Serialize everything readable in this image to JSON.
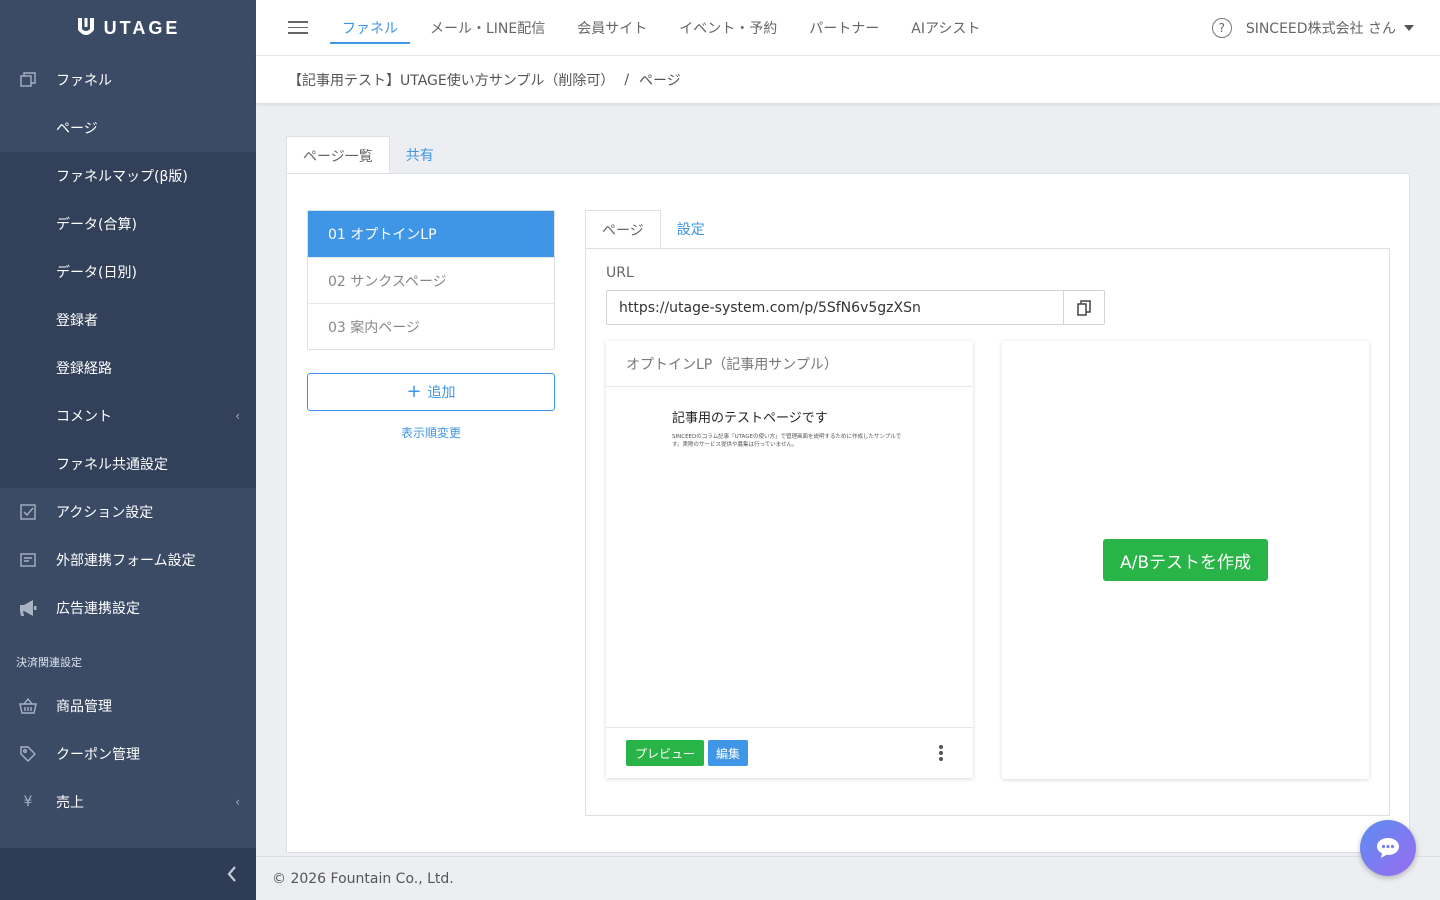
{
  "brand": {
    "name": "UTAGE"
  },
  "sidebar": {
    "items": [
      {
        "label": "ファネル",
        "icon": "copy-icon"
      },
      {
        "label": "ページ"
      },
      {
        "label": "ファネルマップ(β版)"
      },
      {
        "label": "データ(合算)"
      },
      {
        "label": "データ(日別)"
      },
      {
        "label": "登録者"
      },
      {
        "label": "登録経路"
      },
      {
        "label": "コメント"
      },
      {
        "label": "ファネル共通設定"
      },
      {
        "label": "アクション設定",
        "icon": "checkbox-icon"
      },
      {
        "label": "外部連携フォーム設定",
        "icon": "form-icon"
      },
      {
        "label": "広告連携設定",
        "icon": "megaphone-icon"
      }
    ],
    "section_payment": "決済関連設定",
    "payment_items": [
      {
        "label": "商品管理",
        "icon": "basket-icon"
      },
      {
        "label": "クーポン管理",
        "icon": "tag-icon"
      },
      {
        "label": "売上",
        "icon": "yen-icon",
        "glyph": "¥"
      }
    ]
  },
  "header": {
    "tabs": [
      "ファネル",
      "メール・LINE配信",
      "会員サイト",
      "イベント・予約",
      "パートナー",
      "AIアシスト"
    ],
    "help_glyph": "?",
    "user": "SINCEED株式会社 さん"
  },
  "breadcrumb": {
    "funnel": "【記事用テスト】UTAGE使い方サンプル（削除可）",
    "separator": "/",
    "current": "ページ"
  },
  "main_tabs": [
    "ページ一覧",
    "共有"
  ],
  "pages": [
    "01 オプトインLP",
    "02 サンクスページ",
    "03 案内ページ"
  ],
  "add_label": "追加",
  "reorder_label": "表示順変更",
  "sub_tabs": [
    "ページ",
    "設定"
  ],
  "url": {
    "label": "URL",
    "value": "https://utage-system.com/p/5SfN6v5gzXSn"
  },
  "page_card": {
    "title": "オプトインLP（記事用サンプル）",
    "preview_heading": "記事用のテストページです",
    "preview_text": "SINCEEDのコラム記事「UTAGEの使い方」で管理画面を説明するために作成したサンプルです。実際のサービス提供や募集は行っていません。",
    "preview_button": "プレビュー",
    "edit_button": "編集"
  },
  "ab_test_button": "A/Bテストを作成",
  "footer": "© 2026 Fountain Co., Ltd.",
  "colors": {
    "sidebar": "#3b4a65",
    "accent": "#3f95e6",
    "success": "#28b446"
  }
}
